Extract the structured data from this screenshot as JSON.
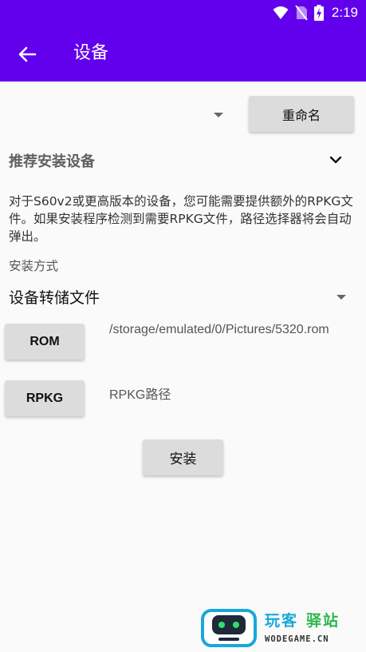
{
  "status_bar": {
    "time": "2:19",
    "icons": [
      "wifi-icon",
      "no-sim-icon",
      "battery-charging-icon"
    ]
  },
  "app_bar": {
    "title": "设备",
    "back_icon": "arrow-back-icon"
  },
  "device_select": {
    "value": "",
    "rename_label": "重命名"
  },
  "recommended": {
    "title": "推荐安装设备",
    "expand_icon": "chevron-down-icon",
    "description": "对于S60v2或更高版本的设备，您可能需要提供额外的RPKG文件。如果安装程序检测到需要RPKG文件，路径选择器将会自动弹出。"
  },
  "install_method": {
    "label": "安装方式",
    "selected": "设备转储文件"
  },
  "rom": {
    "button_label": "ROM",
    "path": "/storage/emulated/0/Pictures/5320.rom"
  },
  "rpkg": {
    "button_label": "RPKG",
    "path": "RPKG路径"
  },
  "install_button": "安装",
  "watermark": {
    "cn_part1": "玩客",
    "cn_part2": "驿站",
    "en": "WODEGAME.CN"
  },
  "colors": {
    "primary": "#6200ee",
    "button_bg": "#dcdcdc",
    "background": "#fafafa"
  }
}
